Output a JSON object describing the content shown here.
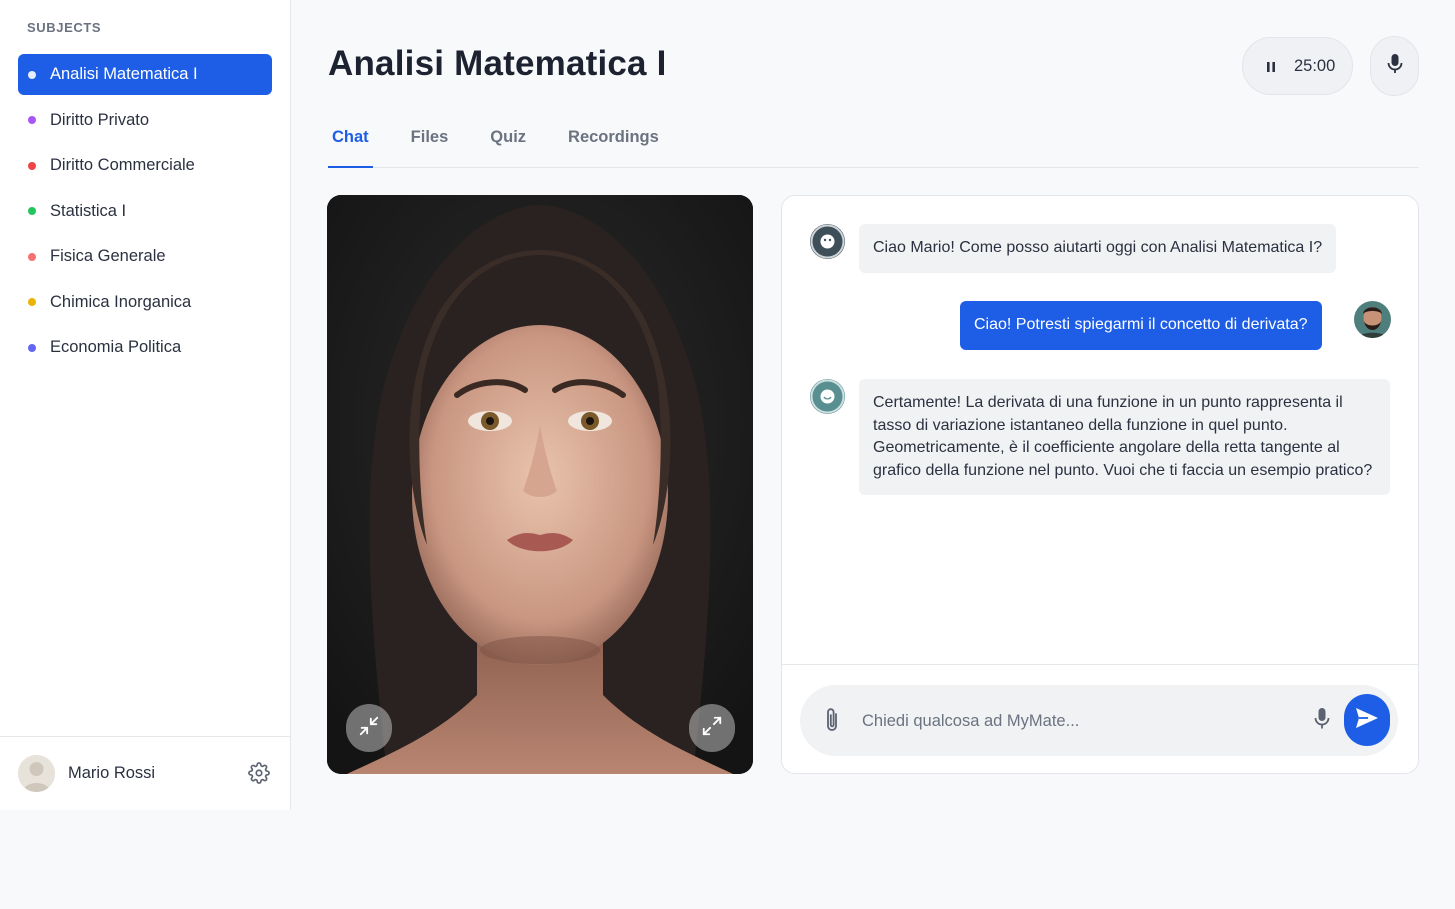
{
  "sidebar": {
    "heading": "SUBJECTS",
    "subjects": [
      {
        "label": "Analisi Matematica I",
        "color": "#ffffff",
        "active": true
      },
      {
        "label": "Diritto Privato",
        "color": "#a855f7"
      },
      {
        "label": "Diritto Commerciale",
        "color": "#ef4444"
      },
      {
        "label": "Statistica I",
        "color": "#22c55e"
      },
      {
        "label": "Fisica Generale",
        "color": "#f87171"
      },
      {
        "label": "Chimica Inorganica",
        "color": "#eab308"
      },
      {
        "label": "Economia Politica",
        "color": "#6366f1"
      }
    ],
    "user": {
      "name": "Mario Rossi"
    }
  },
  "header": {
    "title": "Analisi Matematica I",
    "timer": "25:00"
  },
  "tabs": [
    {
      "label": "Chat",
      "active": true
    },
    {
      "label": "Files"
    },
    {
      "label": "Quiz"
    },
    {
      "label": "Recordings"
    }
  ],
  "chat": {
    "messages": [
      {
        "role": "bot",
        "text": "Ciao Mario! Come posso aiutarti oggi con Analisi Matematica I?"
      },
      {
        "role": "user",
        "text": "Ciao! Potresti spiegarmi il concetto di derivata?"
      },
      {
        "role": "bot",
        "text": "Certamente! La derivata di una funzione in un punto rappresenta il tasso di variazione istantaneo della funzione in quel punto. Geometricamente, è il coefficiente angolare della retta tangente al grafico della funzione nel punto. Vuoi che ti faccia un esempio pratico?"
      }
    ],
    "input_placeholder": "Chiedi qualcosa ad MyMate..."
  },
  "colors": {
    "accent": "#1e5ee6",
    "bot_avatar": "#3f4f5a",
    "bot_avatar_2": "#5a8f91"
  }
}
